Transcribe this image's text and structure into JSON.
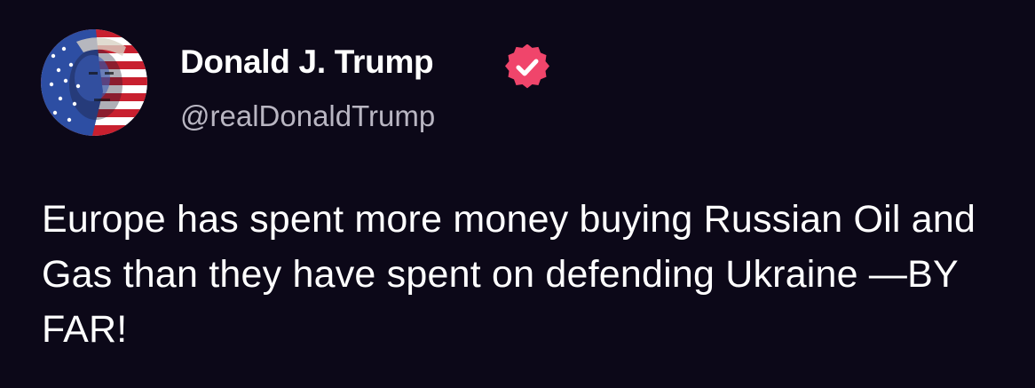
{
  "post": {
    "author": {
      "display_name": "Donald J. Trump",
      "handle": "@realDonaldTrump",
      "verified_icon": "verified-badge-icon",
      "avatar_icon": "avatar-flag-portrait"
    },
    "text": "Europe has spent more money buying Russian Oil and Gas than they have spent on defending Ukraine —BY FAR!"
  },
  "colors": {
    "background": "#0c0818",
    "text": "#ffffff",
    "handle": "#b9b6c2",
    "verified_badge": "#f0456b"
  }
}
